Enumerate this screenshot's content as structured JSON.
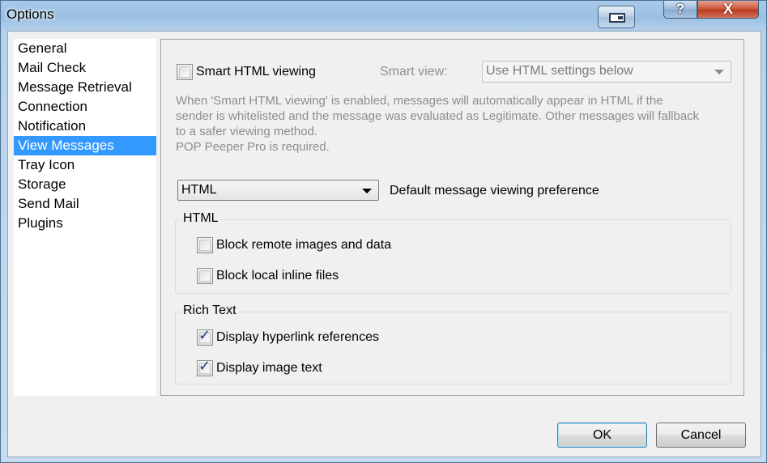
{
  "window": {
    "title": "Options"
  },
  "titlebar": {
    "help_label": "?",
    "close_label": "X"
  },
  "nav": {
    "items": [
      {
        "label": "General"
      },
      {
        "label": "Mail Check"
      },
      {
        "label": "Message Retrieval"
      },
      {
        "label": "Connection"
      },
      {
        "label": "Notification"
      },
      {
        "label": "View Messages",
        "selected": true
      },
      {
        "label": "Tray Icon"
      },
      {
        "label": "Storage"
      },
      {
        "label": "Send Mail"
      },
      {
        "label": "Plugins"
      }
    ]
  },
  "smart": {
    "checkbox_label": "Smart HTML viewing",
    "checked": false,
    "view_label": "Smart view:",
    "view_value": "Use HTML settings below",
    "description": [
      "When 'Smart HTML viewing' is enabled, messages will automatically appear in HTML if the",
      "sender is whitelisted and the message was evaluated as Legitimate.  Other messages will fallback",
      "to a safer viewing method.",
      "POP Peeper Pro is required."
    ]
  },
  "default_view": {
    "value": "HTML",
    "label": "Default message viewing preference"
  },
  "html_group": {
    "title": "HTML",
    "options": [
      {
        "label": "Block remote images and data",
        "checked": false
      },
      {
        "label": "Block local inline files",
        "checked": false
      }
    ]
  },
  "rich_group": {
    "title": "Rich Text",
    "options": [
      {
        "label": "Display hyperlink references",
        "checked": true
      },
      {
        "label": "Display image text",
        "checked": true
      }
    ]
  },
  "buttons": {
    "ok": "OK",
    "cancel": "Cancel"
  },
  "check_glyph": "✓"
}
